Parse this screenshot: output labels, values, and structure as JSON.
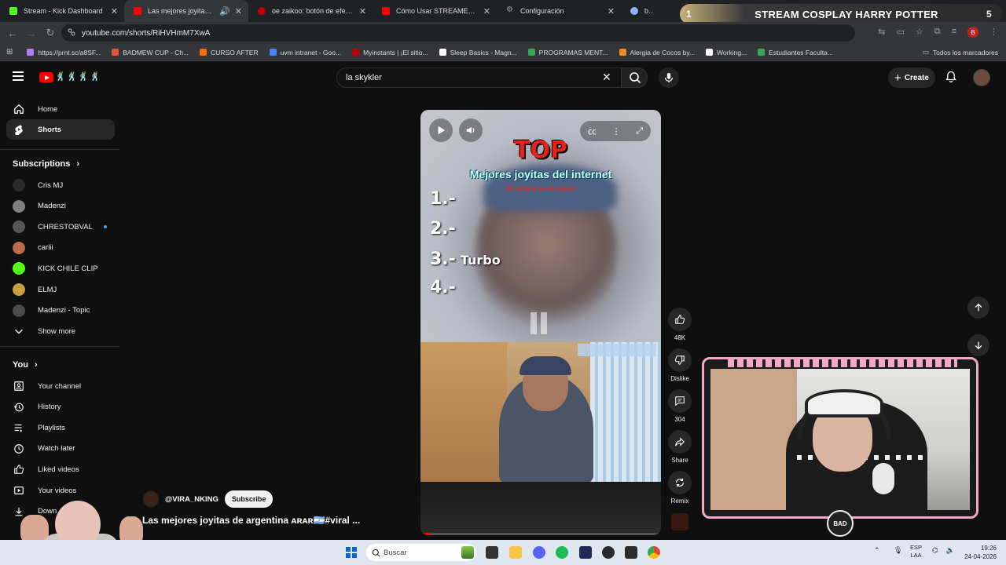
{
  "browser": {
    "tabs": [
      {
        "label": "Stream - Kick Dashboard",
        "color": "#53fc18",
        "active": false
      },
      {
        "label": "Las mejores joyitas de arge",
        "color": "#ff0000",
        "active": true
      },
      {
        "label": "oe zaikoo: botón de efectos de",
        "color": "#c00000",
        "active": false
      },
      {
        "label": "Cómo Usar STREAMERBOT Des",
        "color": "#ff0000",
        "active": false
      },
      {
        "label": "Configuración",
        "color": "#8ab4f8",
        "active": false
      },
      {
        "label": "blasto",
        "color": "#8ab4f8",
        "active": false
      }
    ],
    "url": "youtube.com/shorts/RiHVHmM7XwA",
    "profile_initial": "B",
    "bookmarks": [
      {
        "label": "https://prnt.sc/a8SF...",
        "color": "#b27cf0"
      },
      {
        "label": "BADMEW CUP - Ch...",
        "color": "#e0563a"
      },
      {
        "label": "CURSO AFTER",
        "color": "#ff6a00"
      },
      {
        "label": "uvm intranet - Goo...",
        "color": "#4285f4"
      },
      {
        "label": "Myinstants | ¡El sitio...",
        "color": "#c00000"
      },
      {
        "label": "Sleep Basics - Magn...",
        "color": "#ffffff"
      },
      {
        "label": "PROGRAMAS MENT...",
        "color": "#34a853"
      },
      {
        "label": "Alergia de Cocos by...",
        "color": "#f28b22"
      },
      {
        "label": "Working...",
        "color": "#ffffff"
      },
      {
        "label": "Estudiantes Faculta...",
        "color": "#34a853"
      }
    ],
    "all_bookmarks": "Todos los marcadores"
  },
  "stream_banner": {
    "left_number": "1",
    "title": "STREAM COSPLAY HARRY POTTER",
    "right_number": "5"
  },
  "youtube": {
    "logo_text": "ᵞᵀ",
    "search_query": "la skykler",
    "create_label": "Create",
    "sidebar": {
      "primary": [
        {
          "label": "Home",
          "icon": "home-icon",
          "active": false
        },
        {
          "label": "Shorts",
          "icon": "shorts-icon",
          "active": true
        }
      ],
      "subscriptions_heading": "Subscriptions",
      "subscriptions": [
        {
          "label": "Cris MJ",
          "color": "#2a2a2a",
          "live": false
        },
        {
          "label": "Madenzi",
          "color": "#808080",
          "live": false
        },
        {
          "label": "CHRESTOBVAL",
          "color": "#555555",
          "live": true
        },
        {
          "label": "carlii",
          "color": "#b86a4a",
          "live": false
        },
        {
          "label": "KICK CHILE CLIP",
          "color": "#53fc18",
          "live": false
        },
        {
          "label": "ELMJ",
          "color": "#c8a040",
          "live": false
        },
        {
          "label": "Madenzi - Topic",
          "color": "#4a4a4a",
          "live": false
        }
      ],
      "show_more": "Show more",
      "you_heading": "You",
      "you_items": [
        {
          "label": "Your channel",
          "icon": "channel-icon"
        },
        {
          "label": "History",
          "icon": "history-icon"
        },
        {
          "label": "Playlists",
          "icon": "playlists-icon"
        },
        {
          "label": "Watch later",
          "icon": "watch-later-icon"
        },
        {
          "label": "Liked videos",
          "icon": "like-icon"
        },
        {
          "label": "Your videos",
          "icon": "your-videos-icon"
        },
        {
          "label": "Down",
          "icon": "download-icon"
        }
      ]
    },
    "short": {
      "overlay_top": "TOP",
      "overlay_subtitle": "Mejores joyitas del internet",
      "overlay_note": "(El ultimo es el mejor)",
      "list": [
        {
          "n": "1.-",
          "name": ""
        },
        {
          "n": "2.-",
          "name": ""
        },
        {
          "n": "3.-",
          "name": "Turbo"
        },
        {
          "n": "4.-",
          "name": ""
        }
      ],
      "progress_pct": 4,
      "channel": "@VIRA_NKING",
      "subscribe_label": "Subscribe",
      "title": "Las mejores  joyitas de argentina ᴀʀᴀʀ🇦🇷#viral ..."
    },
    "actions": [
      {
        "label": "48K",
        "icon": "like-icon"
      },
      {
        "label": "Dislike",
        "icon": "dislike-icon"
      },
      {
        "label": "304",
        "icon": "comment-icon"
      },
      {
        "label": "Share",
        "icon": "share-icon"
      },
      {
        "label": "Remix",
        "icon": "remix-icon"
      }
    ]
  },
  "webcam": {
    "badge": "BAD"
  },
  "taskbar": {
    "search_label": "Buscar",
    "lang_line1": "ESP",
    "lang_line2": "LAA",
    "time": "19:26",
    "date": "24-04-2026"
  }
}
